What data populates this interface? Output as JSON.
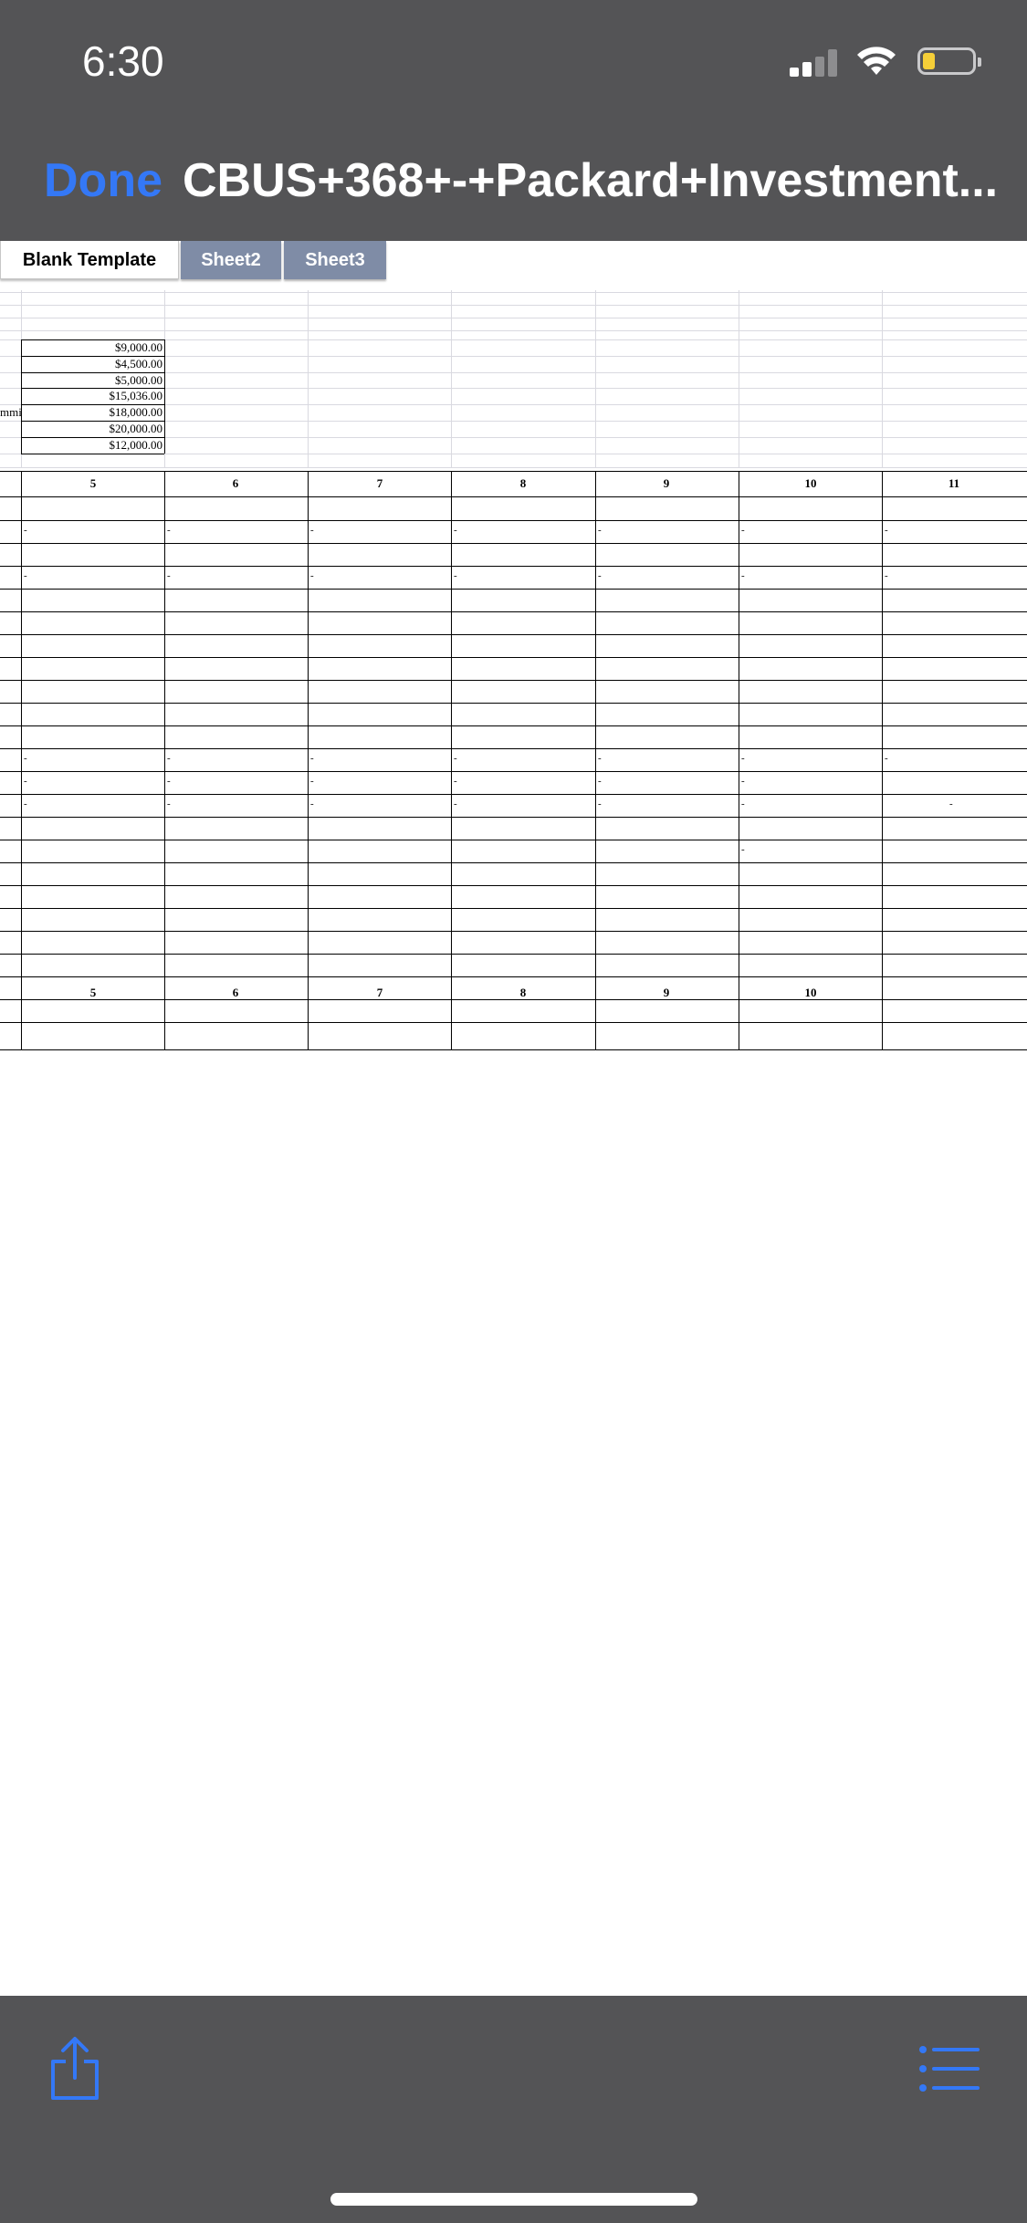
{
  "status_bar": {
    "time": "6:30",
    "icons": [
      "cellular-signal-icon",
      "wifi-icon",
      "battery-icon"
    ],
    "battery_color": "#f6cf38"
  },
  "nav": {
    "done_label": "Done",
    "title": "CBUS+368+-+Packard+Investment...",
    "accent": "#3478f6"
  },
  "tabs": [
    {
      "label": "Blank Template",
      "active": true
    },
    {
      "label": "Sheet2",
      "active": false
    },
    {
      "label": "Sheet3",
      "active": false
    }
  ],
  "sheet": {
    "truncated_label": "mmi",
    "amounts": [
      "$9,000.00",
      "$4,500.00",
      "$5,000.00",
      "$15,036.00",
      "$18,000.00",
      "$20,000.00",
      "$12,000.00"
    ],
    "column_numbers_top": [
      "5",
      "6",
      "7",
      "8",
      "9",
      "10",
      "11"
    ],
    "column_numbers_bottom": [
      "5",
      "6",
      "7",
      "8",
      "9",
      "10"
    ],
    "dash": "-"
  },
  "toolbar": {
    "share_icon": "share-icon",
    "list_icon": "list-icon"
  }
}
